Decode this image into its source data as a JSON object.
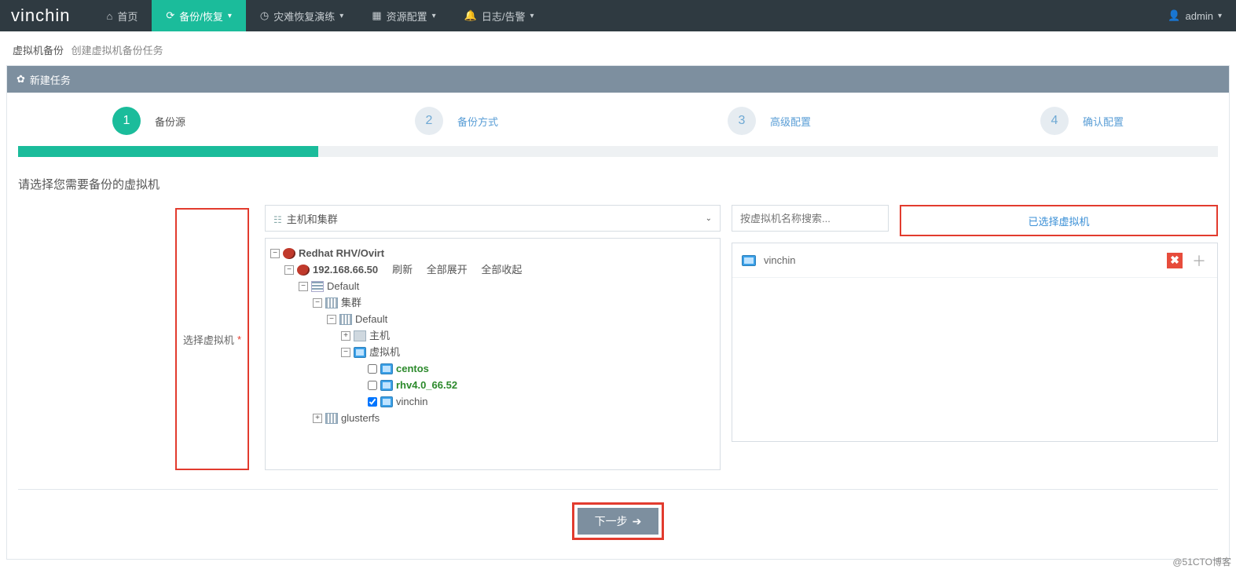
{
  "brand": "vinchin",
  "nav": {
    "home": "首页",
    "backup": "备份/恢复",
    "dr": "灾难恢复演练",
    "resource": "资源配置",
    "log": "日志/告警"
  },
  "user": {
    "name": "admin"
  },
  "breadcrumb": {
    "main": "虚拟机备份",
    "sub": "创建虚拟机备份任务"
  },
  "panel": {
    "title": "新建任务"
  },
  "wizard": {
    "s1": {
      "num": "1",
      "label": "备份源"
    },
    "s2": {
      "num": "2",
      "label": "备份方式"
    },
    "s3": {
      "num": "3",
      "label": "高级配置"
    },
    "s4": {
      "num": "4",
      "label": "确认配置"
    }
  },
  "prompt": "请选择您需要备份的虚拟机",
  "label": {
    "selectVm": "选择虚拟机",
    "required": "*"
  },
  "selector": {
    "label": "主机和集群"
  },
  "search": {
    "placeholder": "按虚拟机名称搜索..."
  },
  "rightHead": "已选择虚拟机",
  "tree": {
    "root": "Redhat RHV/Ovirt",
    "host": "192.168.66.50",
    "links": {
      "refresh": "刷新",
      "expand": "全部展开",
      "collapse": "全部收起"
    },
    "dc": "Default",
    "cluster": "集群",
    "clDefault": "Default",
    "hostNode": "主机",
    "vmNode": "虚拟机",
    "vm1": "centos",
    "vm2": "rhv4.0_66.52",
    "vm3": "vinchin",
    "gluster": "glusterfs"
  },
  "selected": {
    "item0": "vinchin"
  },
  "buttons": {
    "next": "下一步"
  },
  "watermark": "@51CTO博客"
}
